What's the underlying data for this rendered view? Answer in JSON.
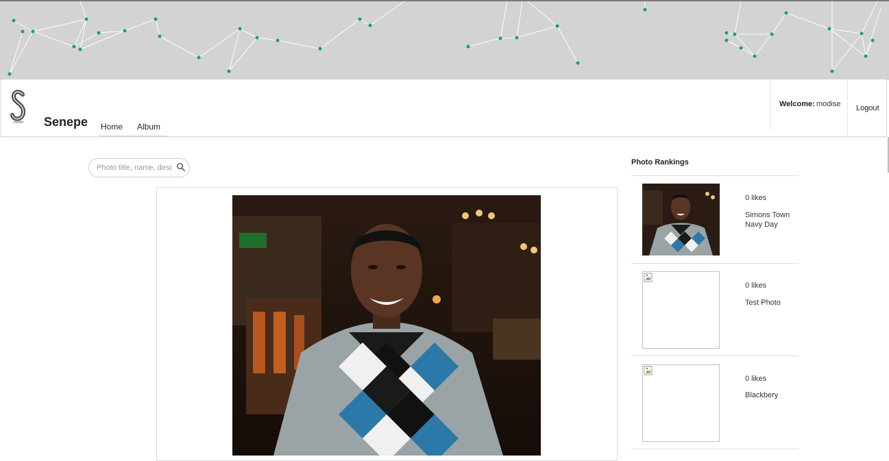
{
  "header": {
    "brand": "Senepe",
    "nav": [
      {
        "label": "Home"
      },
      {
        "label": "Album"
      }
    ],
    "welcome_label": "Welcome:",
    "username": "modise",
    "logout_label": "Logout"
  },
  "search": {
    "placeholder": "Photo title, name, desc",
    "icon": "search-icon"
  },
  "main_photo": {
    "alt": "Man smiling in patterned sweater"
  },
  "rankings": {
    "title": "Photo Rankings",
    "items": [
      {
        "likes": "0 likes",
        "title": "Simons Town Navy Day",
        "image": "photo"
      },
      {
        "likes": "0 likes",
        "title": "Test Photo",
        "image": "broken"
      },
      {
        "likes": "0 likes",
        "title": "Blackbery",
        "image": "broken"
      }
    ]
  },
  "colors": {
    "banner_bg": "#d3d3d3",
    "node_color": "#1a9e77",
    "line_color": "#ffffff"
  }
}
